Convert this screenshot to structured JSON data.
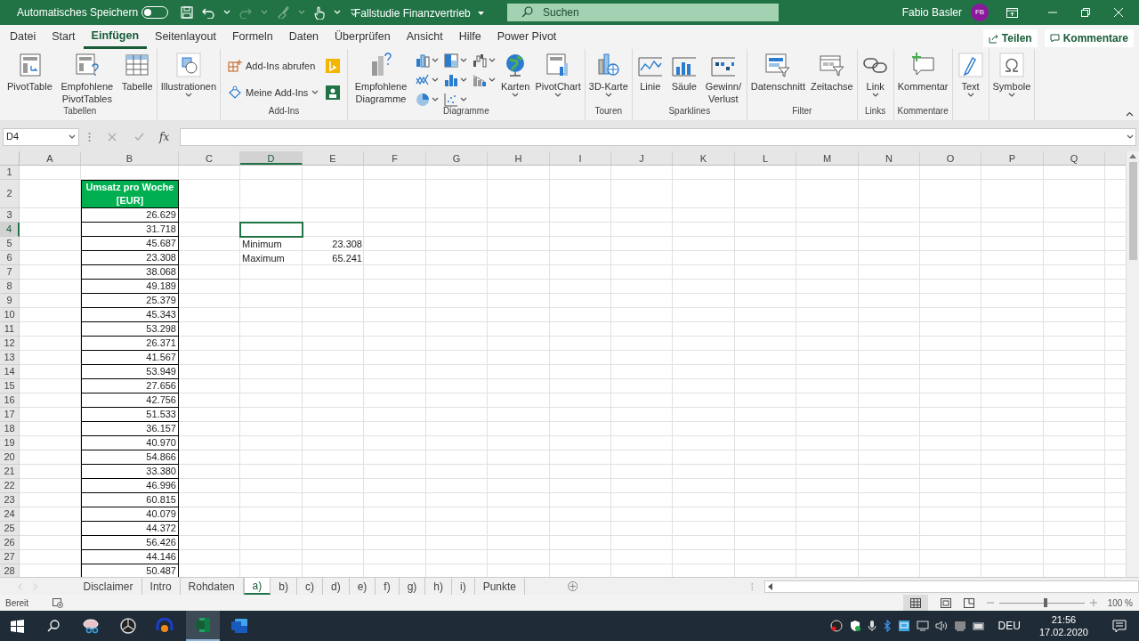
{
  "title_bar": {
    "autosave_label": "Automatisches Speichern",
    "autosave_on": false,
    "document_title": "Fallstudie Finanzvertrieb",
    "search": {
      "placeholder": "Suchen"
    },
    "user_name": "Fabio Basler",
    "user_initials": "FB"
  },
  "ribbon_tabs": [
    {
      "label": "Datei",
      "selected": false
    },
    {
      "label": "Start",
      "selected": false
    },
    {
      "label": "Einfügen",
      "selected": true
    },
    {
      "label": "Seitenlayout",
      "selected": false
    },
    {
      "label": "Formeln",
      "selected": false
    },
    {
      "label": "Daten",
      "selected": false
    },
    {
      "label": "Überprüfen",
      "selected": false
    },
    {
      "label": "Ansicht",
      "selected": false
    },
    {
      "label": "Hilfe",
      "selected": false
    },
    {
      "label": "Power Pivot",
      "selected": false
    }
  ],
  "share_button": "Teilen",
  "comments_button": "Kommentare",
  "ribbon_groups": [
    {
      "label": "Tabellen",
      "items": [
        {
          "kind": "large",
          "label": "PivotTable",
          "dropdown": false
        },
        {
          "kind": "large",
          "label": "Empfohlene PivotTables",
          "dropdown": false
        },
        {
          "kind": "large",
          "label": "Tabelle",
          "dropdown": false
        }
      ]
    },
    {
      "items": [
        {
          "kind": "large",
          "label": "Illustrationen",
          "dropdown": true
        }
      ]
    },
    {
      "label": "Add-Ins",
      "items": [
        {
          "kind": "small",
          "label": "Add-Ins abrufen",
          "dropdown": false
        },
        {
          "kind": "small",
          "label": "Meine Add-Ins",
          "dropdown": true
        }
      ]
    },
    {
      "label": "Diagramme",
      "items": [
        {
          "kind": "large",
          "label": "Empfohlene Diagramme",
          "dropdown": false
        },
        {
          "kind": "chart-grid"
        },
        {
          "kind": "large",
          "label": "Karten",
          "dropdown": true
        },
        {
          "kind": "large",
          "label": "PivotChart",
          "dropdown": true
        }
      ]
    },
    {
      "label": "Touren",
      "items": [
        {
          "kind": "large",
          "label": "3D-Karte",
          "dropdown": true
        }
      ]
    },
    {
      "label": "Sparklines",
      "items": [
        {
          "kind": "large",
          "label": "Linie",
          "dropdown": false
        },
        {
          "kind": "large",
          "label": "Säule",
          "dropdown": false
        },
        {
          "kind": "large",
          "label": "Gewinn/Verlust",
          "dropdown": false
        }
      ]
    },
    {
      "label": "Filter",
      "items": [
        {
          "kind": "large",
          "label": "Datenschnitt",
          "dropdown": false
        },
        {
          "kind": "large",
          "label": "Zeitachse",
          "dropdown": false
        }
      ]
    },
    {
      "label": "Links",
      "items": [
        {
          "kind": "large",
          "label": "Link",
          "dropdown": true
        }
      ]
    },
    {
      "label": "Kommentare",
      "items": [
        {
          "kind": "large",
          "label": "Kommentar",
          "dropdown": false
        }
      ]
    },
    {
      "items": [
        {
          "kind": "large",
          "label": "Text",
          "dropdown": true
        }
      ]
    },
    {
      "items": [
        {
          "kind": "large",
          "label": "Symbole",
          "dropdown": true
        }
      ]
    }
  ],
  "formula_bar": {
    "name_box": "D4",
    "function_label": "fx"
  },
  "columns": [
    {
      "label": "A",
      "selected": false
    },
    {
      "label": "B",
      "selected": false
    },
    {
      "label": "C",
      "selected": false
    },
    {
      "label": "D",
      "selected": true
    },
    {
      "label": "E",
      "selected": false
    },
    {
      "label": "F",
      "selected": false
    },
    {
      "label": "G",
      "selected": false
    },
    {
      "label": "H",
      "selected": false
    },
    {
      "label": "I",
      "selected": false
    },
    {
      "label": "J",
      "selected": false
    },
    {
      "label": "K",
      "selected": false
    },
    {
      "label": "L",
      "selected": false
    },
    {
      "label": "M",
      "selected": false
    },
    {
      "label": "N",
      "selected": false
    },
    {
      "label": "O",
      "selected": false
    },
    {
      "label": "P",
      "selected": false
    },
    {
      "label": "Q",
      "selected": false
    }
  ],
  "rows": [
    {
      "label": "1",
      "selected": false
    },
    {
      "label": "2",
      "selected": false,
      "b_header": "Umsatz pro Woche [EUR]"
    },
    {
      "label": "3",
      "selected": false,
      "b": "26.629"
    },
    {
      "label": "4",
      "selected": true,
      "b": "31.718"
    },
    {
      "label": "5",
      "selected": false,
      "b": "45.687",
      "d": "Minimum",
      "e": "23.308"
    },
    {
      "label": "6",
      "selected": false,
      "b": "23.308",
      "d": "Maximum",
      "e": "65.241"
    },
    {
      "label": "7",
      "selected": false,
      "b": "38.068"
    },
    {
      "label": "8",
      "selected": false,
      "b": "49.189"
    },
    {
      "label": "9",
      "selected": false,
      "b": "25.379"
    },
    {
      "label": "10",
      "selected": false,
      "b": "45.343"
    },
    {
      "label": "11",
      "selected": false,
      "b": "53.298"
    },
    {
      "label": "12",
      "selected": false,
      "b": "26.371"
    },
    {
      "label": "13",
      "selected": false,
      "b": "41.567"
    },
    {
      "label": "14",
      "selected": false,
      "b": "53.949"
    },
    {
      "label": "15",
      "selected": false,
      "b": "27.656"
    },
    {
      "label": "16",
      "selected": false,
      "b": "42.756"
    },
    {
      "label": "17",
      "selected": false,
      "b": "51.533"
    },
    {
      "label": "18",
      "selected": false,
      "b": "36.157"
    },
    {
      "label": "19",
      "selected": false,
      "b": "40.970"
    },
    {
      "label": "20",
      "selected": false,
      "b": "54.866"
    },
    {
      "label": "21",
      "selected": false,
      "b": "33.380"
    },
    {
      "label": "22",
      "selected": false,
      "b": "46.996"
    },
    {
      "label": "23",
      "selected": false,
      "b": "60.815"
    },
    {
      "label": "24",
      "selected": false,
      "b": "40.079"
    },
    {
      "label": "25",
      "selected": false,
      "b": "44.372"
    },
    {
      "label": "26",
      "selected": false,
      "b": "56.426"
    },
    {
      "label": "27",
      "selected": false,
      "b": "44.146"
    },
    {
      "label": "28",
      "selected": false,
      "b": "50.487"
    }
  ],
  "sheet_tabs": [
    {
      "label": "Disclaimer",
      "selected": false
    },
    {
      "label": "Intro",
      "selected": false
    },
    {
      "label": "Rohdaten",
      "selected": false
    },
    {
      "label": "a)",
      "selected": true
    },
    {
      "label": "b)",
      "selected": false
    },
    {
      "label": "c)",
      "selected": false
    },
    {
      "label": "d)",
      "selected": false
    },
    {
      "label": "e)",
      "selected": false
    },
    {
      "label": "f)",
      "selected": false
    },
    {
      "label": "g)",
      "selected": false
    },
    {
      "label": "h)",
      "selected": false
    },
    {
      "label": "i)",
      "selected": false
    },
    {
      "label": "Punkte",
      "selected": false
    }
  ],
  "status_bar": {
    "text": "Bereit",
    "zoom": "100 %",
    "zoom_slider": {
      "level": 0.55
    }
  },
  "taskbar": {
    "language": "DEU",
    "time": "21:56",
    "date": "17.02.2020"
  }
}
